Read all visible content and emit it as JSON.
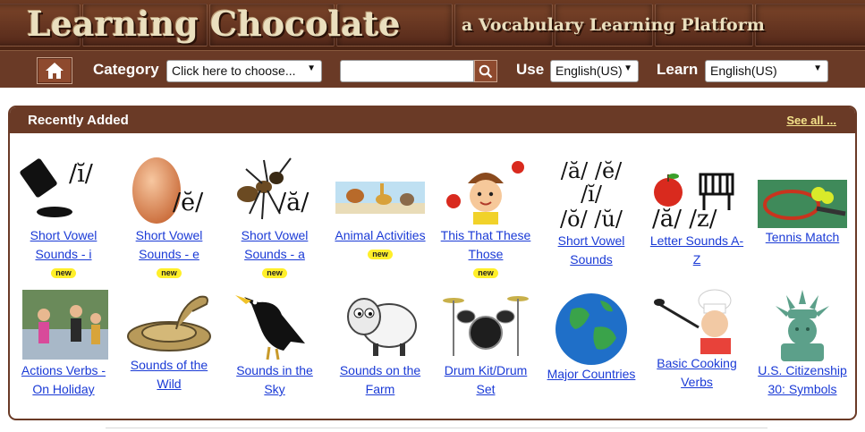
{
  "banner": {
    "title": "Learning Chocolate",
    "subtitle": "a Vocabulary Learning Platform"
  },
  "nav": {
    "category_label": "Category",
    "category_value": "Click here to choose...",
    "search_placeholder": "",
    "use_label": "Use",
    "use_value": "English(US)",
    "learn_label": "Learn",
    "learn_value": "English(US)",
    "home_icon": "home-icon",
    "search_icon": "search-icon"
  },
  "recent": {
    "title": "Recently Added",
    "see_all": "See all ...",
    "badge": "new",
    "items": [
      {
        "label": "Short Vowel Sounds - i",
        "new": true,
        "phonetic": "/ĭ/"
      },
      {
        "label": "Short Vowel Sounds - e",
        "new": true,
        "phonetic": "/ĕ/"
      },
      {
        "label": "Short Vowel Sounds - a",
        "new": true,
        "phonetic": "/ă/"
      },
      {
        "label": "Animal Activities",
        "new": true
      },
      {
        "label": "This That These Those",
        "new": true
      },
      {
        "label": "Short Vowel Sounds",
        "new": false,
        "phonetic_lines": [
          "/ă/ /ĕ/",
          "/ĭ/",
          "/ŏ/ /ŭ/"
        ]
      },
      {
        "label": "Letter Sounds A-Z",
        "new": false,
        "phonetic": "/ă/ /z/"
      },
      {
        "label": "Tennis Match",
        "new": false
      },
      {
        "label": "Actions Verbs - On Holiday",
        "new": false
      },
      {
        "label": "Sounds of the Wild",
        "new": false
      },
      {
        "label": "Sounds in the Sky",
        "new": false
      },
      {
        "label": "Sounds on the Farm",
        "new": false
      },
      {
        "label": "Drum Kit/Drum Set",
        "new": false
      },
      {
        "label": "Major Countries",
        "new": false
      },
      {
        "label": "Basic Cooking Verbs",
        "new": false
      },
      {
        "label": "U.S. Citizenship 30: Symbols",
        "new": false
      }
    ]
  },
  "colors": {
    "brown": "#6a3a26",
    "link": "#1a3ad6",
    "badge": "#ffef2a",
    "see_all": "#f3e28a"
  }
}
